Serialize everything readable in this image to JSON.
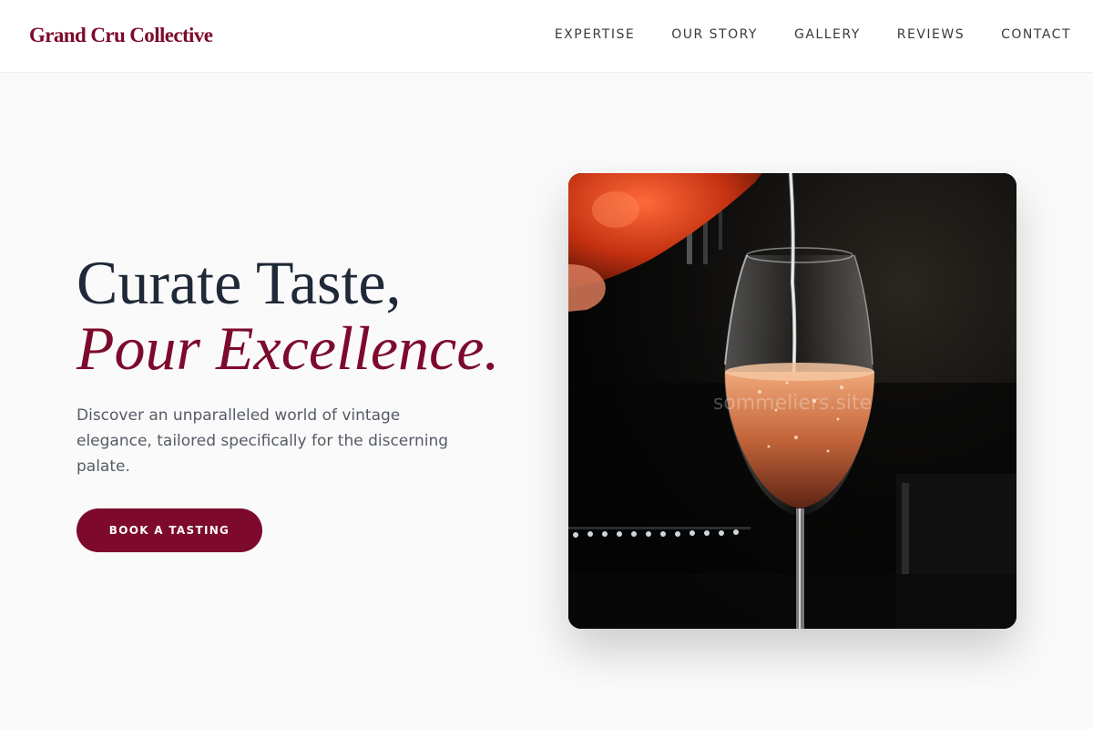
{
  "brand": {
    "name": "Grand Cru Collective",
    "color": "#7d0a2c"
  },
  "nav": {
    "items": [
      {
        "label": "EXPERTISE"
      },
      {
        "label": "OUR STORY"
      },
      {
        "label": "GALLERY"
      },
      {
        "label": "REVIEWS"
      },
      {
        "label": "CONTACT"
      }
    ]
  },
  "hero": {
    "headline_line1": "Curate Taste,",
    "headline_line2": "Pour Excellence.",
    "subtitle": "Discover an unparalleled world of vintage elegance, tailored specifically for the discerning palate.",
    "cta_label": "BOOK A TASTING",
    "image": {
      "description_icon": "wine-glass-pour-photo",
      "watermark": "sommeliers.site"
    }
  },
  "colors": {
    "accent": "#7d0a2c",
    "text_dark": "#1f2937",
    "text_muted": "#555b66",
    "background": "#fafafa"
  }
}
